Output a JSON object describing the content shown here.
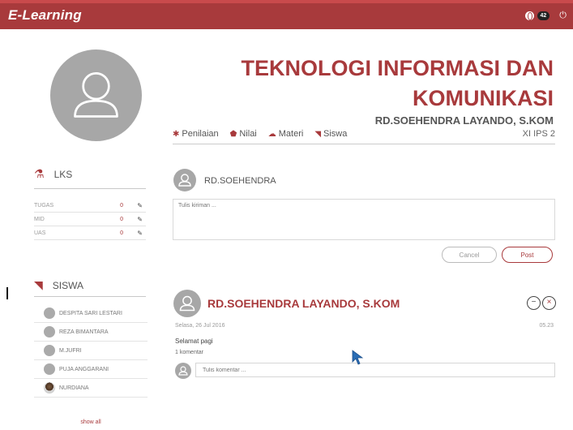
{
  "app": {
    "title": "E-Learning",
    "notification_count": "42"
  },
  "profile": {
    "avatar_icon": "user-icon"
  },
  "course": {
    "title": "TEKNOLOGI INFORMASI DAN KOMUNIKASI",
    "teacher": "RD.SOEHENDRA LAYANDO, S.KOM",
    "class_name": "XI IPS 2"
  },
  "tabs": [
    {
      "label": "Penilaian",
      "icon": "gear-icon"
    },
    {
      "label": "Nilai",
      "icon": "shield-icon"
    },
    {
      "label": "Materi",
      "icon": "cloud-icon"
    },
    {
      "label": "Siswa",
      "icon": "rss-icon"
    }
  ],
  "lks": {
    "heading": "LKS",
    "rows": [
      {
        "label": "TUGAS",
        "value": "0"
      },
      {
        "label": "MID",
        "value": "0"
      },
      {
        "label": "UAS",
        "value": "0"
      }
    ]
  },
  "siswa": {
    "heading": "SISWA",
    "students": [
      "DESPITA SARI LESTARI",
      "REZA BIMANTARA",
      "M.JUFRI",
      "PUJA ANGGARANI",
      "NURDIANA"
    ],
    "show_all": "show all"
  },
  "composer": {
    "name": "RD.SOEHENDRA",
    "placeholder": "Tulis kiriman ...",
    "cancel_label": "Cancel",
    "post_label": "Post"
  },
  "post": {
    "author": "RD.SOEHENDRA LAYANDO, S.KOM",
    "date": "Selasa, 26 Jul 2016",
    "time": "05.23",
    "body": "Selamat pagi",
    "comment_count": "1 komentar",
    "comment_placeholder": "Tulis komentar ..."
  },
  "colors": {
    "primary": "#a83a3c",
    "avatar_gray": "#a7a7a7"
  }
}
